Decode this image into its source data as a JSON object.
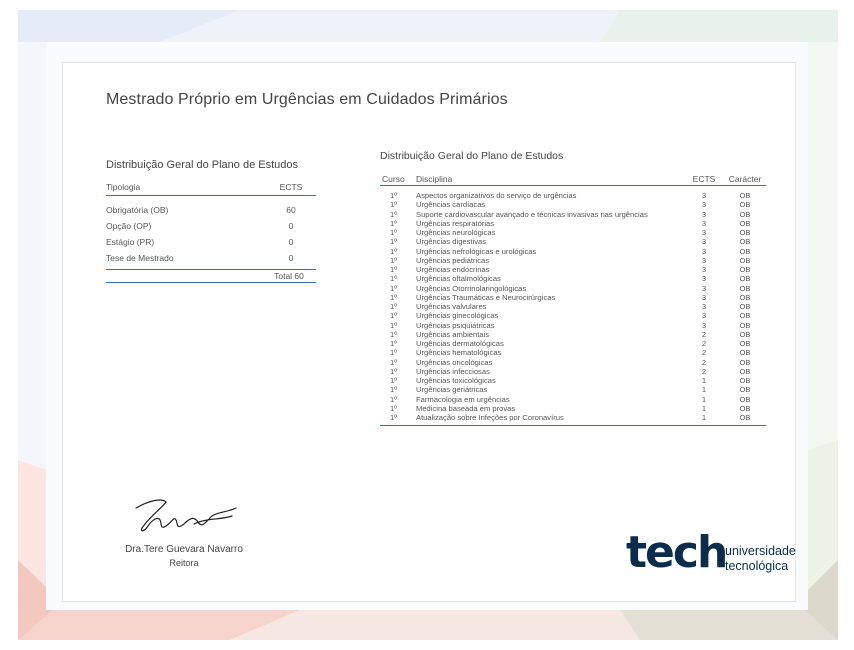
{
  "title": "Mestrado Próprio em Urgências em Cuidados Primários",
  "summary": {
    "title": "Distribuição Geral do Plano de Estudos",
    "col_tipologia": "Tipologia",
    "col_ects": "ECTS",
    "rows": [
      {
        "tipologia": "Obrigatória (OB)",
        "ects": "60"
      },
      {
        "tipologia": "Opção (OP)",
        "ects": "0"
      },
      {
        "tipologia": "Estágio (PR)",
        "ects": "0"
      },
      {
        "tipologia": "Tese de Mestrado",
        "ects": "0"
      }
    ],
    "total": "Total 60"
  },
  "courses": {
    "title": "Distribuição Geral do Plano de Estudos",
    "col_curso": "Curso",
    "col_disciplina": "Disciplina",
    "col_ects": "ECTS",
    "col_caracter": "Carácter",
    "rows": [
      {
        "curso": "1º",
        "disciplina": "Aspectos organizativos do serviço de urgências",
        "ects": "3",
        "caracter": "OB"
      },
      {
        "curso": "1º",
        "disciplina": "Urgências cardíacas",
        "ects": "3",
        "caracter": "OB"
      },
      {
        "curso": "1º",
        "disciplina": "Suporte cardiovascular avançado e técnicas invasivas nas urgências",
        "ects": "3",
        "caracter": "OB"
      },
      {
        "curso": "1º",
        "disciplina": "Urgências respiratórias",
        "ects": "3",
        "caracter": "OB"
      },
      {
        "curso": "1º",
        "disciplina": "Urgências neurológicas",
        "ects": "3",
        "caracter": "OB"
      },
      {
        "curso": "1º",
        "disciplina": "Urgências digestivas",
        "ects": "3",
        "caracter": "OB"
      },
      {
        "curso": "1º",
        "disciplina": "Urgências nefrológicas e urológicas",
        "ects": "3",
        "caracter": "OB"
      },
      {
        "curso": "1º",
        "disciplina": "Urgências pediátricas",
        "ects": "3",
        "caracter": "OB"
      },
      {
        "curso": "1º",
        "disciplina": "Urgências endócrinas",
        "ects": "3",
        "caracter": "OB"
      },
      {
        "curso": "1º",
        "disciplina": "Urgências oftalmológicas",
        "ects": "3",
        "caracter": "OB"
      },
      {
        "curso": "1º",
        "disciplina": "Urgências Otorrinolaringológicas",
        "ects": "3",
        "caracter": "OB"
      },
      {
        "curso": "1º",
        "disciplina": "Urgências Traumáticas e Neurocirúrgicas",
        "ects": "3",
        "caracter": "OB"
      },
      {
        "curso": "1º",
        "disciplina": "Urgências valvulares",
        "ects": "3",
        "caracter": "OB"
      },
      {
        "curso": "1º",
        "disciplina": "Urgências ginecológicas",
        "ects": "3",
        "caracter": "OB"
      },
      {
        "curso": "1º",
        "disciplina": "Urgências psiquiátricas",
        "ects": "3",
        "caracter": "OB"
      },
      {
        "curso": "1º",
        "disciplina": "Urgências ambientais",
        "ects": "2",
        "caracter": "OB"
      },
      {
        "curso": "1º",
        "disciplina": "Urgências dermatológicas",
        "ects": "2",
        "caracter": "OB"
      },
      {
        "curso": "1º",
        "disciplina": "Urgências hematológicas",
        "ects": "2",
        "caracter": "OB"
      },
      {
        "curso": "1º",
        "disciplina": "Urgências oncológicas",
        "ects": "2",
        "caracter": "OB"
      },
      {
        "curso": "1º",
        "disciplina": "Urgências infecciosas",
        "ects": "2",
        "caracter": "OB"
      },
      {
        "curso": "1º",
        "disciplina": "Urgências toxicológicas",
        "ects": "1",
        "caracter": "OB"
      },
      {
        "curso": "1º",
        "disciplina": "Urgências geriátricas",
        "ects": "1",
        "caracter": "OB"
      },
      {
        "curso": "1º",
        "disciplina": "Farmacologia em urgências",
        "ects": "1",
        "caracter": "OB"
      },
      {
        "curso": "1º",
        "disciplina": "Medicina baseada em provas",
        "ects": "1",
        "caracter": "OB"
      },
      {
        "curso": "1º",
        "disciplina": "Atualização sobre Infeções por Coronavírus",
        "ects": "1",
        "caracter": "OB"
      }
    ]
  },
  "signature": {
    "name": "Dra.Tere Guevara Navarro",
    "role": "Reitora"
  },
  "logo": {
    "word": "tech",
    "sub_line1": "universidade",
    "sub_line2": "tecnológica",
    "color": "#0b2d4b"
  },
  "colors": {
    "rule": "#2b74b8"
  }
}
